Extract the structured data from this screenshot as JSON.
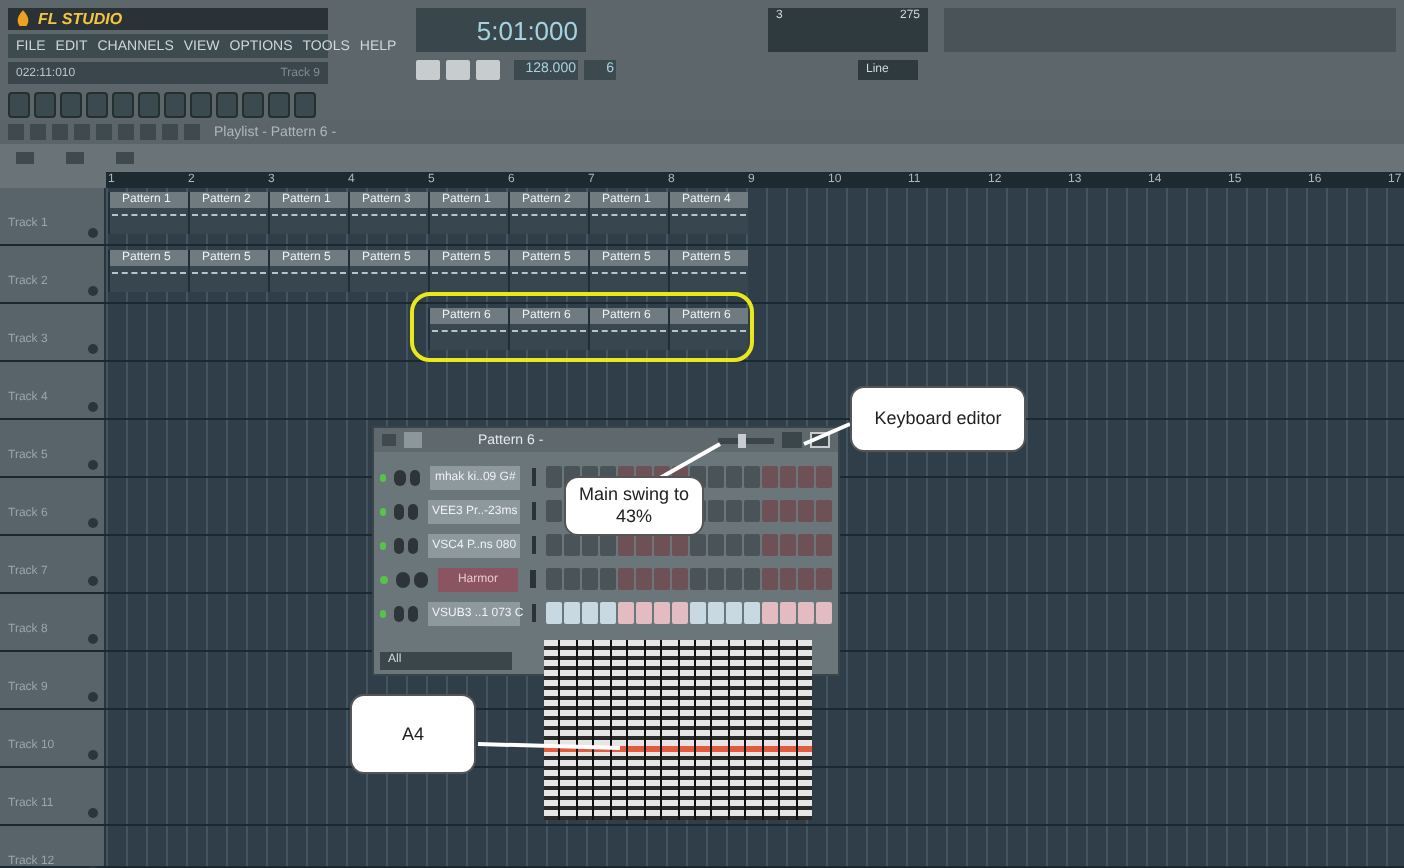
{
  "app": {
    "logo": "FL STUDIO",
    "menu": [
      "FILE",
      "EDIT",
      "CHANNELS",
      "VIEW",
      "OPTIONS",
      "TOOLS",
      "HELP"
    ],
    "hint": "022:11:010",
    "hint_target": "Track 9",
    "time": "5:01:000",
    "tempo": "128.000",
    "pattern_number": "6",
    "cpu": "3",
    "memory": "275",
    "snap": "Line"
  },
  "playlist": {
    "title": "Playlist - Pattern 6 -",
    "ruler": [
      "1",
      "2",
      "3",
      "4",
      "5",
      "6",
      "7",
      "8",
      "9",
      "10",
      "11",
      "12",
      "13",
      "14",
      "15",
      "16",
      "17"
    ],
    "tracks": [
      {
        "name": "Track 1",
        "highlighted": false,
        "clips": [
          {
            "label": "Pattern 1"
          },
          {
            "label": "Pattern 2"
          },
          {
            "label": "Pattern 1"
          },
          {
            "label": "Pattern 3"
          },
          {
            "label": "Pattern 1"
          },
          {
            "label": "Pattern 2"
          },
          {
            "label": "Pattern 1"
          },
          {
            "label": "Pattern 4"
          }
        ]
      },
      {
        "name": "Track 2",
        "highlighted": false,
        "clips": [
          {
            "label": "Pattern 5"
          },
          {
            "label": "Pattern 5"
          },
          {
            "label": "Pattern 5"
          },
          {
            "label": "Pattern 5"
          },
          {
            "label": "Pattern 5"
          },
          {
            "label": "Pattern 5"
          },
          {
            "label": "Pattern 5"
          },
          {
            "label": "Pattern 5"
          }
        ]
      },
      {
        "name": "Track 3",
        "highlighted": true,
        "clips": [
          {
            "label": "Pattern 6"
          },
          {
            "label": "Pattern 6"
          },
          {
            "label": "Pattern 6"
          },
          {
            "label": "Pattern 6"
          }
        ]
      },
      {
        "name": "Track 4",
        "highlighted": false
      },
      {
        "name": "Track 5",
        "highlighted": false
      },
      {
        "name": "Track 6",
        "highlighted": false
      },
      {
        "name": "Track 7",
        "highlighted": false
      },
      {
        "name": "Track 8",
        "highlighted": false
      },
      {
        "name": "Track 9",
        "highlighted": false
      },
      {
        "name": "Track 10",
        "highlighted": false
      },
      {
        "name": "Track 11",
        "highlighted": false
      },
      {
        "name": "Track 12",
        "highlighted": false
      }
    ]
  },
  "channel_rack": {
    "title": "Pattern 6 -",
    "swing": {
      "level": 0.43
    },
    "filter": "All",
    "channels": [
      {
        "name": "mhak ki..09 G#",
        "selected": false,
        "steps_on": false
      },
      {
        "name": "VEE3 Pr..-23ms",
        "selected": false,
        "steps_on": false
      },
      {
        "name": "VSC4 P..ns 080",
        "selected": false,
        "steps_on": false
      },
      {
        "name": "Harmor",
        "selected": true,
        "steps_on": false
      },
      {
        "name": "VSUB3 ..1 073 C",
        "selected": false,
        "steps_on": true
      }
    ]
  },
  "callouts": [
    {
      "text": "Keyboard editor"
    },
    {
      "text": "Main swing to 43%"
    },
    {
      "text": "A4"
    }
  ]
}
